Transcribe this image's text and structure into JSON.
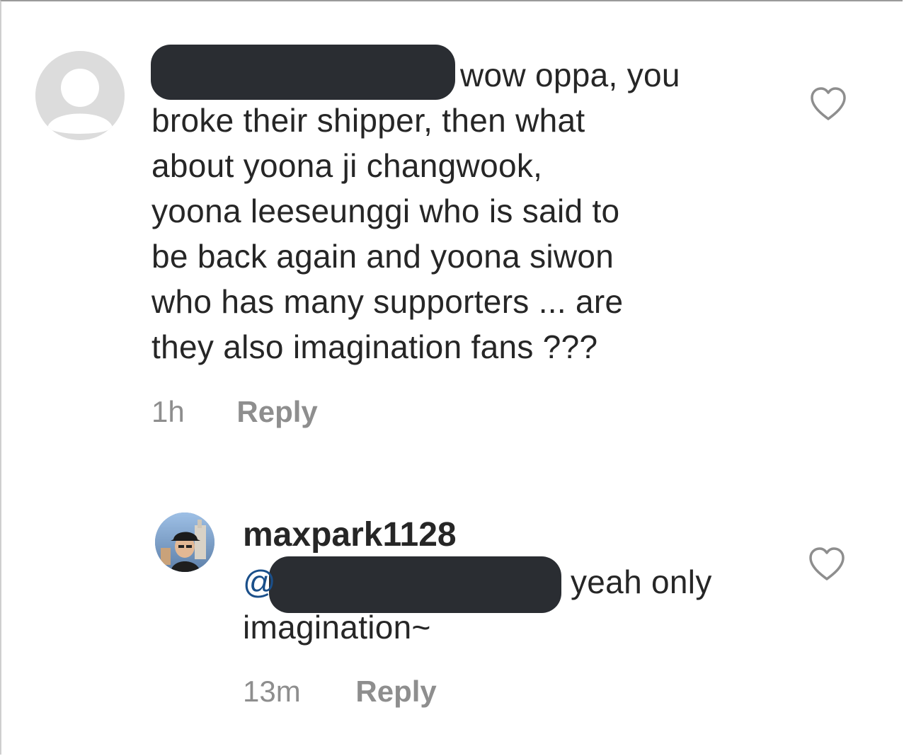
{
  "comments": [
    {
      "avatar": "default-avatar-icon",
      "username_redacted": true,
      "text_first_line_tail": "wow oppa, you",
      "text_rest": "broke their shipper, then what\nabout yoona ji changwook,\nyoona leeseunggi who is said to\nbe back again and yoona siwon\nwho has many supporters ... are\nthey also imagination fans ???",
      "time": "1h",
      "reply_label": "Reply",
      "like_icon": "heart-outline-icon"
    },
    {
      "avatar": "user-photo-avatar",
      "username": "maxpark1128",
      "mention_prefix": "@",
      "mention_redacted": true,
      "text_tail": "yeah only",
      "text_rest": "imagination~",
      "time": "13m",
      "reply_label": "Reply",
      "like_icon": "heart-outline-icon"
    }
  ],
  "colors": {
    "text": "#262626",
    "meta": "#8e8e8e",
    "mention": "#1a4f8a",
    "redaction": "#2a2d32",
    "default_avatar": "#dedede"
  }
}
